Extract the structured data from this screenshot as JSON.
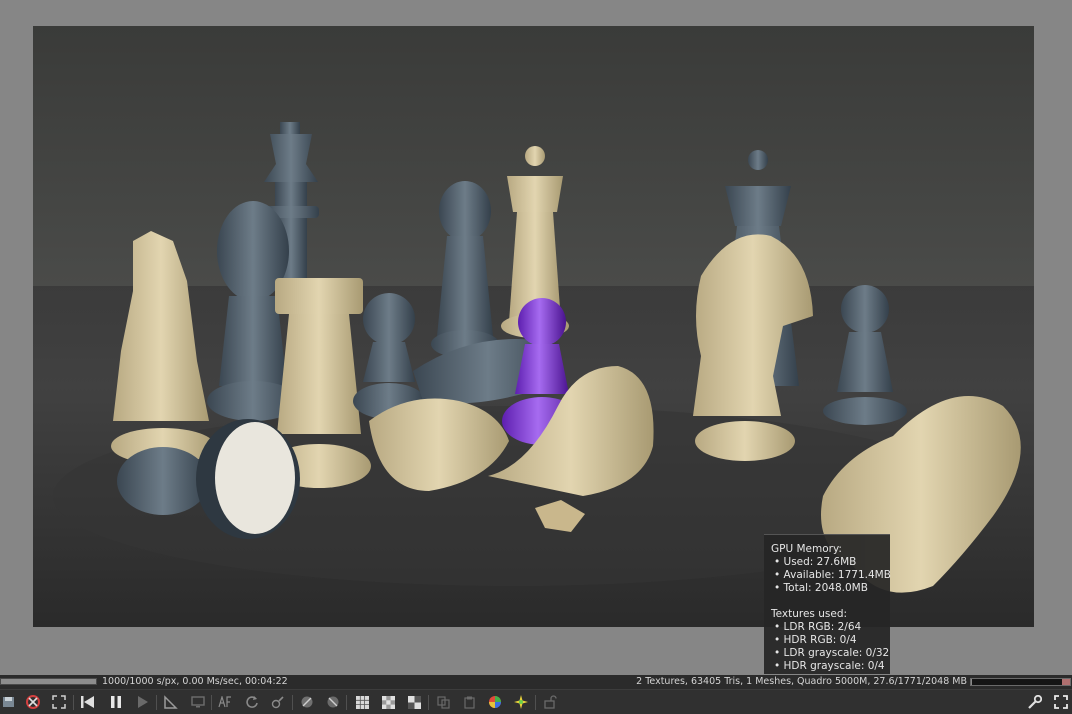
{
  "gpu_memory": {
    "heading": "GPU Memory:",
    "used": "• Used: 27.6MB",
    "available": "• Available: 1771.4MB",
    "total": "• Total: 2048.0MB"
  },
  "textures": {
    "heading": "Textures used:",
    "ldr_rgb": "• LDR RGB: 2/64",
    "hdr_rgb": "• HDR RGB: 0/4",
    "ldr_gray": "• LDR grayscale: 0/32",
    "hdr_gray": "• HDR grayscale: 0/4"
  },
  "status": {
    "render_info": "1000/1000 s/px, 0.00 Ms/sec, 00:04:22",
    "scene_info": "2 Textures, 63405 Tris, 1 Meshes, Quadro 5000M, 27.6/1771/2048 MB",
    "render_progress": 1.0,
    "memory_usage": 0.0135
  },
  "colors": {
    "background": "#868686",
    "statusbar": "#2b2b2b",
    "toolbar": "#303030",
    "tooltip": "#262626"
  }
}
